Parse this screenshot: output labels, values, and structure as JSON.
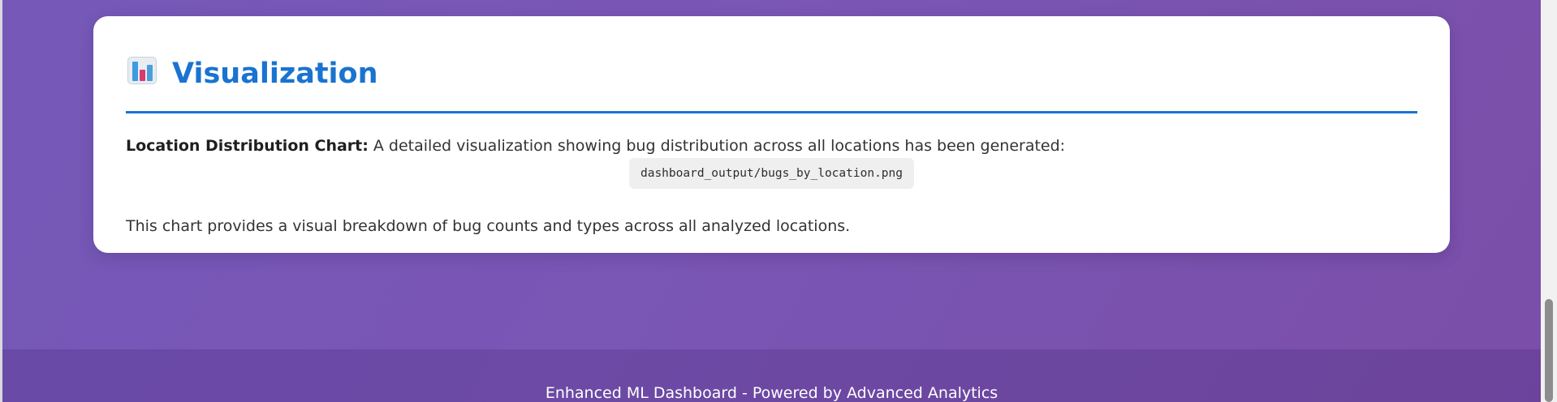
{
  "visualization_section": {
    "title": "Visualization",
    "icon": "bar-chart-icon",
    "description_label": "Location Distribution Chart:",
    "description_text": " A detailed visualization showing bug distribution across all locations has been generated:",
    "file_path": "dashboard_output/bugs_by_location.png",
    "summary": "This chart provides a visual breakdown of bug counts and types across all analyzed locations."
  },
  "footer": {
    "text": "Enhanced ML Dashboard - Powered by Advanced Analytics"
  },
  "colors": {
    "accent": "#1a73d0",
    "background_gradient_start": "#7558b8",
    "background_gradient_end": "#7a4ea8",
    "card_background": "#ffffff"
  }
}
